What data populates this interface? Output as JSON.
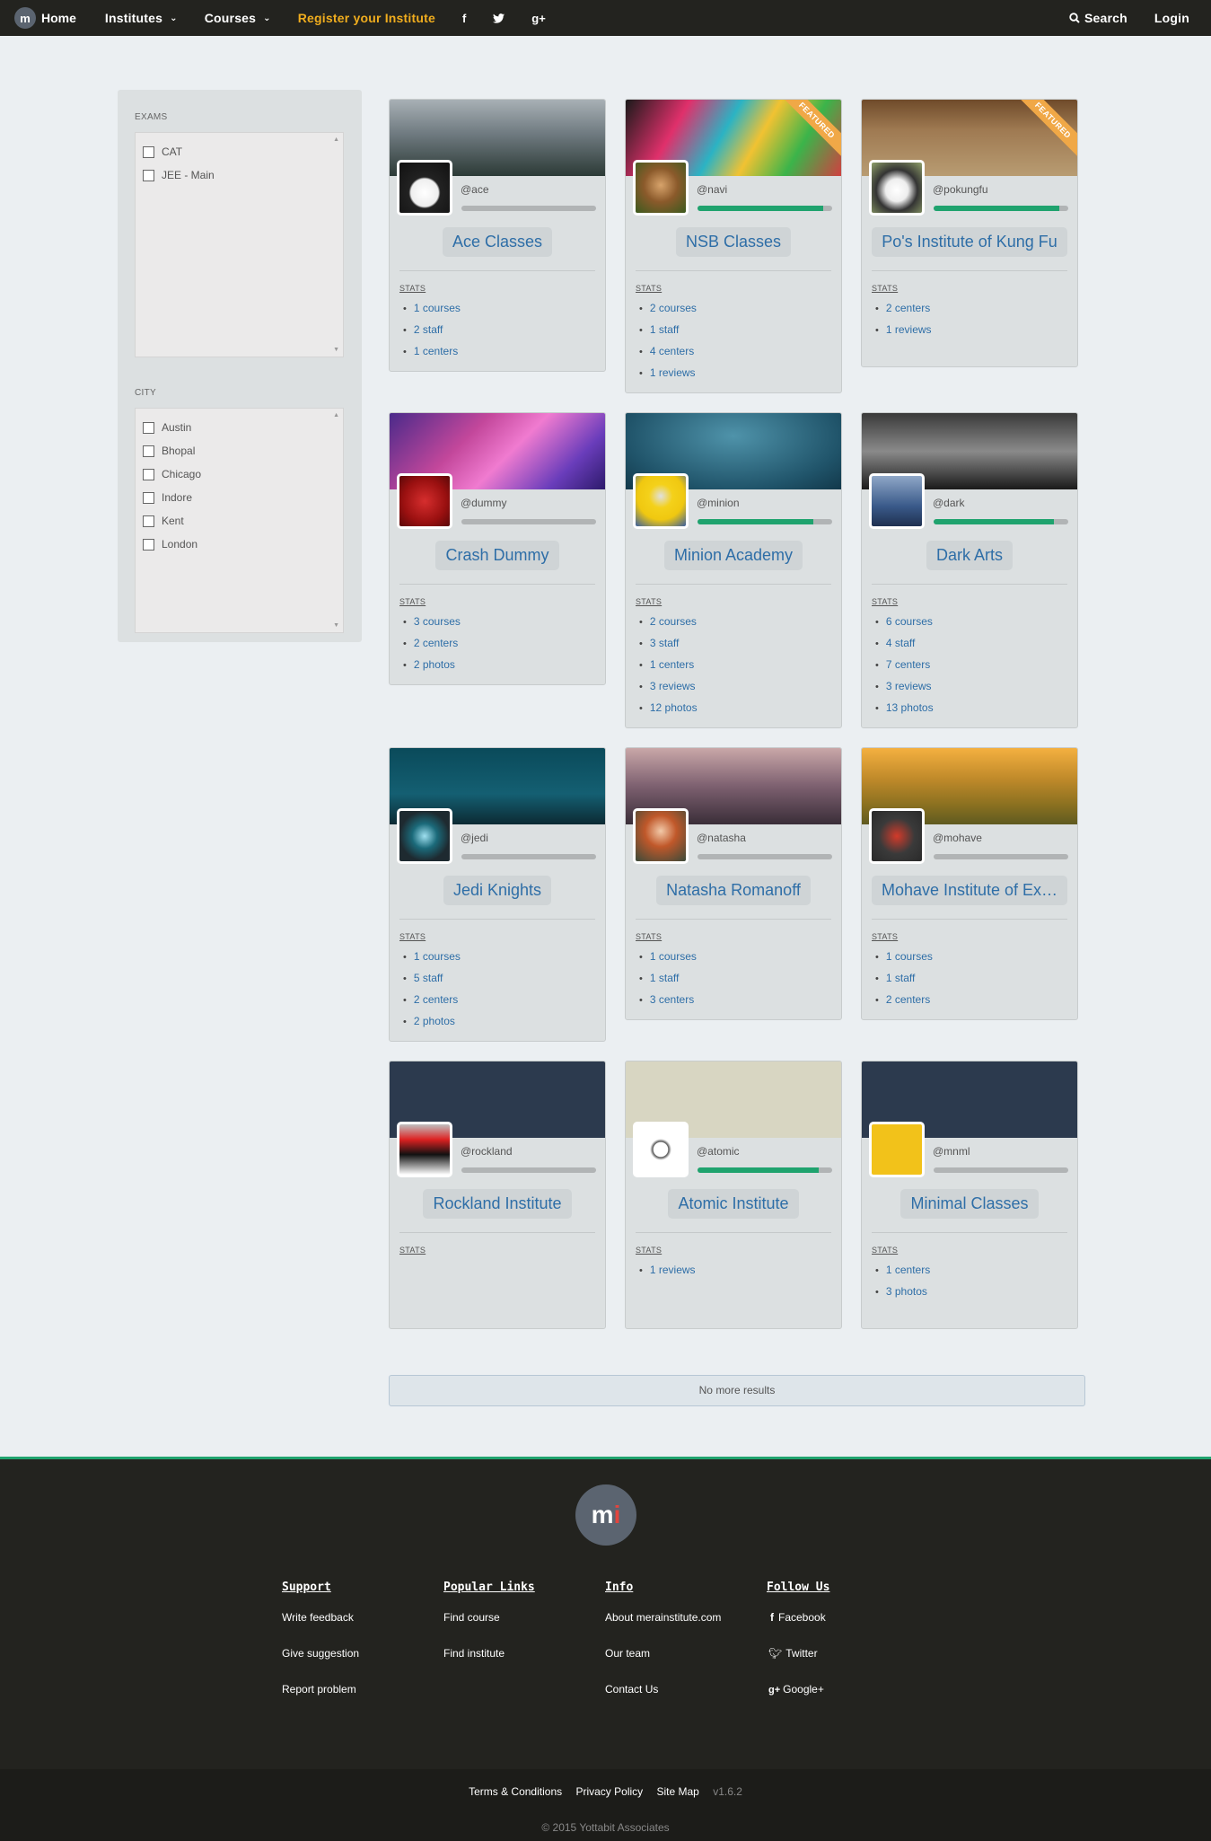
{
  "navbar": {
    "home": "Home",
    "institutes": "Institutes",
    "courses": "Courses",
    "register": "Register your Institute",
    "facebook": "f",
    "twitter": "t",
    "gplus": "g+",
    "search": "Search",
    "login": "Login"
  },
  "filters": {
    "exams": {
      "title": "EXAMS",
      "options": [
        "CAT",
        "JEE - Main"
      ]
    },
    "city": {
      "title": "CITY",
      "options": [
        "Austin",
        "Bhopal",
        "Chicago",
        "Indore",
        "Kent",
        "London"
      ]
    }
  },
  "cards": [
    {
      "handle": "@ace",
      "name": "Ace Classes",
      "stats_label": "STATS",
      "stats": [
        "1 courses",
        "2 staff",
        "1 centers"
      ],
      "featured": false,
      "progress": 0,
      "featured_label": ""
    },
    {
      "handle": "@navi",
      "name": "NSB Classes",
      "stats_label": "STATS",
      "stats": [
        "2 courses",
        "1 staff",
        "4 centers",
        "1 reviews"
      ],
      "featured": true,
      "featured_label": "FEATURED",
      "progress": 0.93
    },
    {
      "handle": "@pokungfu",
      "name": "Po's Institute of Kung Fu",
      "stats_label": "STATS",
      "stats": [
        "2 centers",
        "1 reviews"
      ],
      "featured": true,
      "featured_label": "FEATURED",
      "progress": 0.93
    },
    {
      "handle": "@dummy",
      "name": "Crash Dummy",
      "stats_label": "STATS",
      "stats": [
        "3 courses",
        "2 centers",
        "2 photos"
      ],
      "featured": false,
      "progress": 0,
      "featured_label": ""
    },
    {
      "handle": "@minion",
      "name": "Minion Academy",
      "stats_label": "STATS",
      "stats": [
        "2 courses",
        "3 staff",
        "1 centers",
        "3 reviews",
        "12 photos"
      ],
      "featured": false,
      "progress": 0.86,
      "featured_label": ""
    },
    {
      "handle": "@dark",
      "name": "Dark Arts",
      "stats_label": "STATS",
      "stats": [
        "6 courses",
        "4 staff",
        "7 centers",
        "3 reviews",
        "13 photos"
      ],
      "featured": false,
      "progress": 0.89,
      "featured_label": ""
    },
    {
      "handle": "@jedi",
      "name": "Jedi Knights",
      "stats_label": "STATS",
      "stats": [
        "1 courses",
        "5 staff",
        "2 centers",
        "2 photos"
      ],
      "featured": false,
      "progress": 0,
      "featured_label": ""
    },
    {
      "handle": "@natasha",
      "name": "Natasha Romanoff",
      "stats_label": "STATS",
      "stats": [
        "1 courses",
        "1 staff",
        "3 centers"
      ],
      "featured": false,
      "progress": 0,
      "featured_label": ""
    },
    {
      "handle": "@mohave",
      "name": "Mohave Institute of Ex…",
      "stats_label": "STATS",
      "stats": [
        "1 courses",
        "1 staff",
        "2 centers"
      ],
      "featured": false,
      "progress": 0,
      "featured_label": ""
    },
    {
      "handle": "@rockland",
      "name": "Rockland Institute",
      "stats_label": "STATS",
      "stats": [],
      "featured": false,
      "progress": 0,
      "featured_label": ""
    },
    {
      "handle": "@atomic",
      "name": "Atomic Institute",
      "stats_label": "STATS",
      "stats": [
        "1 reviews"
      ],
      "featured": false,
      "progress": 0.9,
      "featured_label": ""
    },
    {
      "handle": "@mnml",
      "name": "Minimal Classes",
      "stats_label": "STATS",
      "stats": [
        "1 centers",
        "3 photos"
      ],
      "featured": false,
      "progress": 0,
      "featured_label": ""
    }
  ],
  "no_more": "No more results",
  "footer": {
    "logo": "mi",
    "support": {
      "title": "Support",
      "links": [
        "Write feedback",
        "Give suggestion",
        "Report problem"
      ]
    },
    "popular": {
      "title": "Popular Links",
      "links": [
        "Find course",
        "Find institute"
      ]
    },
    "info": {
      "title": "Info",
      "links": [
        "About merainstitute.com",
        "Our team",
        "Contact Us"
      ]
    },
    "follow": {
      "title": "Follow Us",
      "links": [
        "Facebook",
        "Twitter",
        "Google+"
      ]
    },
    "bottom": {
      "terms": "Terms & Conditions",
      "privacy": "Privacy Policy",
      "sitemap": "Site Map",
      "version": "v1.6.2"
    },
    "copyright": "© 2015 Yottabit Associates"
  },
  "colors": {
    "accent": "#1fa36e",
    "register": "#f0ad1e",
    "link": "#2e6ea7",
    "ribbon": "#f0a847"
  }
}
